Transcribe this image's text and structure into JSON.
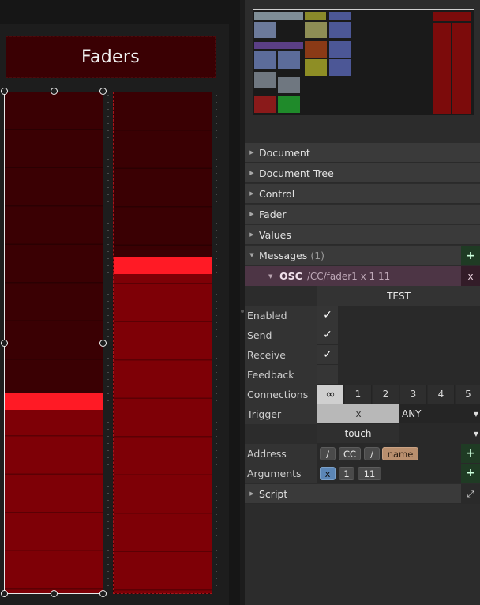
{
  "canvas": {
    "title": "Faders",
    "fader1": {
      "value": 0.38,
      "selected": true
    },
    "fader2": {
      "value": 0.66,
      "selected": false
    }
  },
  "colors": {
    "fader_bg": "#3a0003",
    "fader_fill": "#7e0006",
    "fader_handle": "#ff1a25",
    "osc_row": "#4d3545",
    "add_button": "#1f3b24",
    "chip_name": "#b98f6e",
    "chip_var": "#5b86b6"
  },
  "inspector": {
    "sections": {
      "document": "Document",
      "document_tree": "Document Tree",
      "control": "Control",
      "fader": "Fader",
      "values": "Values",
      "messages": "Messages",
      "messages_count": "(1)",
      "script": "Script"
    },
    "osc": {
      "label": "OSC",
      "path": "/CC/fader1 x 1 11",
      "remove": "x",
      "test": "TEST"
    },
    "props": {
      "enabled": "Enabled",
      "send": "Send",
      "receive": "Receive",
      "feedback": "Feedback",
      "connections": "Connections",
      "trigger": "Trigger",
      "address": "Address",
      "arguments": "Arguments"
    },
    "check_mark": "✓",
    "connections": [
      "∞",
      "1",
      "2",
      "3",
      "4",
      "5"
    ],
    "trigger": {
      "var": "x",
      "mode": "ANY",
      "event": "touch"
    },
    "address_chips": [
      "/",
      "CC",
      "/",
      "name"
    ],
    "argument_chips": [
      "x",
      "1",
      "11"
    ],
    "plus": "+"
  }
}
